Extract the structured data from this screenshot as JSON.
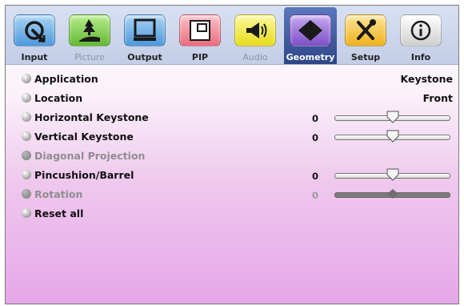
{
  "tabs": [
    {
      "key": "input",
      "label": "Input",
      "icon": "input-icon",
      "color": "#6fb3e8",
      "state": "normal"
    },
    {
      "key": "picture",
      "label": "Picture",
      "icon": "picture-icon",
      "color": "#8fd45a",
      "state": "disabled"
    },
    {
      "key": "output",
      "label": "Output",
      "icon": "monitor-icon",
      "color": "#6fb3e8",
      "state": "normal"
    },
    {
      "key": "pip",
      "label": "PIP",
      "icon": "pip-icon",
      "color": "#f08a98",
      "state": "normal"
    },
    {
      "key": "audio",
      "label": "Audio",
      "icon": "speaker-icon",
      "color": "#f3ea3c",
      "state": "disabled"
    },
    {
      "key": "geometry",
      "label": "Geometry",
      "icon": "geometry-icon",
      "color": "#9a6fd8",
      "state": "active"
    },
    {
      "key": "setup",
      "label": "Setup",
      "icon": "tools-icon",
      "color": "#f6c640",
      "state": "normal"
    },
    {
      "key": "info",
      "label": "Info",
      "icon": "info-icon",
      "color": "#e8e8e8",
      "state": "normal"
    }
  ],
  "menu": [
    {
      "label": "Application",
      "value": "Keystone",
      "enabled": true
    },
    {
      "label": "Location",
      "value": "Front",
      "enabled": true
    },
    {
      "label": "Horizontal Keystone",
      "number": "0",
      "slider": 0.5,
      "enabled": true
    },
    {
      "label": "Vertical Keystone",
      "number": "0",
      "slider": 0.5,
      "enabled": true
    },
    {
      "label": "Diagonal Projection",
      "enabled": false
    },
    {
      "label": "Pincushion/Barrel",
      "number": "0",
      "slider": 0.5,
      "enabled": true
    },
    {
      "label": "Rotation",
      "number": "0",
      "slider": 0.5,
      "enabled": false
    },
    {
      "label": "Reset all",
      "enabled": true
    }
  ]
}
